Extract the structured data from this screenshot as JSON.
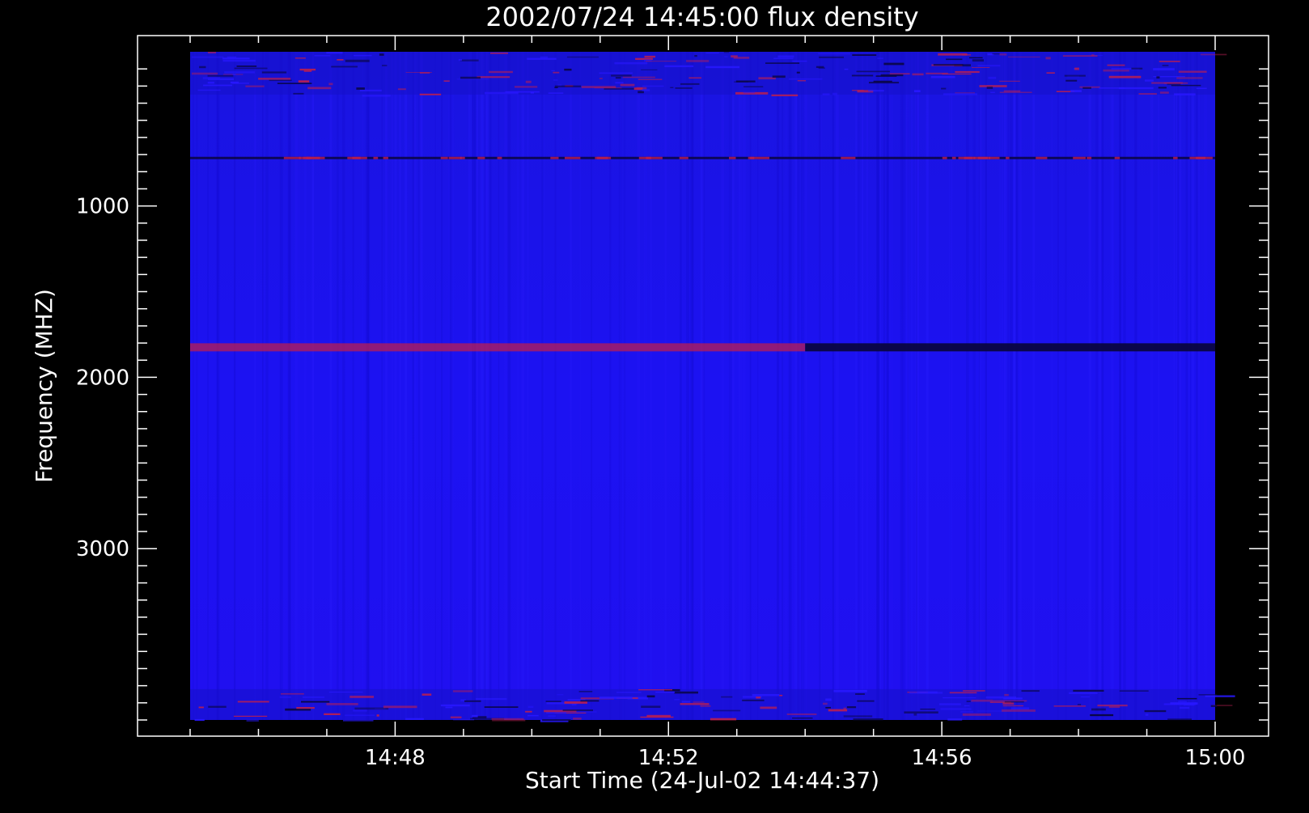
{
  "chart_data": {
    "type": "heatmap",
    "title": "2002/07/24 14:45:00 flux density",
    "xlabel": "Start Time (24-Jul-02 14:44:37)",
    "ylabel": "Frequency (MHZ)",
    "x_start": "14:45:00",
    "x_end": "15:00:00",
    "xlim_minutes": [
      0,
      15
    ],
    "ylim": [
      100,
      4000
    ],
    "y_inverted": true,
    "x_ticks": [
      {
        "label": "14:48",
        "minute": 3
      },
      {
        "label": "14:52",
        "minute": 7
      },
      {
        "label": "14:56",
        "minute": 11
      },
      {
        "label": "15:00",
        "minute": 15
      }
    ],
    "y_ticks": [
      {
        "label": "1000",
        "value": 1000
      },
      {
        "label": "2000",
        "value": 2000
      },
      {
        "label": "3000",
        "value": 3000
      }
    ],
    "colors": {
      "background": "#000000",
      "axes": "#ffffff",
      "baseline": "#1a12f0",
      "enhanced": "#b81e52",
      "depressed": "#0a0640"
    },
    "features": [
      {
        "kind": "band",
        "f_min": 100,
        "f_max": 350,
        "t_start": 0,
        "t_end": 15,
        "description": "noisy emission band"
      },
      {
        "kind": "line",
        "frequency": 720,
        "t_start": 0,
        "t_end": 15
      },
      {
        "kind": "line",
        "frequency": 1825,
        "t_start": 0,
        "t_end": 9,
        "style": "enhanced"
      },
      {
        "kind": "line",
        "frequency": 1825,
        "t_start": 9,
        "t_end": 15,
        "style": "depressed"
      },
      {
        "kind": "band",
        "f_min": 3820,
        "f_max": 4000,
        "t_start": 0,
        "t_end": 15,
        "description": "noisy edge band"
      }
    ]
  }
}
